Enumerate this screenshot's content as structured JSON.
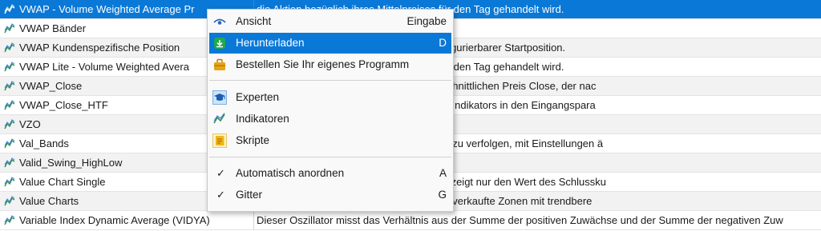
{
  "rows": [
    {
      "name": "VWAP - Volume Weighted Average Pr",
      "desc": "die Aktion bezüglich ihres Mittelpreises für den Tag gehandelt wird."
    },
    {
      "name": "VWAP Bänder",
      "desc": ""
    },
    {
      "name": "VWAP Kundenspezifische Position",
      "desc": "erage Price) Berechnung, jedoch mit konfigurierbarer Startposition."
    },
    {
      "name": "VWAP Lite - Volume Weighted Avera",
      "desc": "die Aktion bezüglich ihres Mittelpreises für den Tag gehandelt wird."
    },
    {
      "name": "VWAP_Close",
      "desc": "mmung der Liquidität-Punkte, den durchschnittlichen Preis Close, der nac"
    },
    {
      "name": "VWAP_Close_HTF",
      "desc": "nderungsmöglichkeit des Timeframes des Indikators in den Eingangspara"
    },
    {
      "name": "VZO",
      "desc": ""
    },
    {
      "name": "Val_Bands",
      "desc": "er Kerzen des Charts, der hilft Kurslücken zu verfolgen, mit Einstellungen ä"
    },
    {
      "name": "Valid_Swing_HighLow",
      "desc": ""
    },
    {
      "name": "Value Chart Single",
      "desc": "ginalen Value Chart, aber dieser Indikator zeigt nur den Wert des Schlussku"
    },
    {
      "name": "Value Charts",
      "desc": "reis-Indikator, er zeigt überkaufte und überverkaufte Zonen mit trendbere"
    },
    {
      "name": "Variable Index Dynamic Average (VIDYA)",
      "desc": "Dieser Oszillator misst das Verhältnis aus der Summe der positiven Zuwächse und der Summe der negativen Zuw"
    }
  ],
  "menu": {
    "items": [
      {
        "icon": "eye-icon",
        "label": "Ansicht",
        "key": "Eingabe"
      },
      {
        "icon": "download-icon",
        "label": "Herunterladen",
        "key": "D"
      },
      {
        "icon": "order-program-icon",
        "label": "Bestellen Sie Ihr eigenes Programm",
        "key": ""
      },
      {
        "icon": "experts-icon",
        "label": "Experten",
        "key": ""
      },
      {
        "icon": "indicators-icon",
        "label": "Indikatoren",
        "key": ""
      },
      {
        "icon": "scripts-icon",
        "label": "Skripte",
        "key": ""
      },
      {
        "icon": "check-icon",
        "label": "Automatisch anordnen",
        "key": "A"
      },
      {
        "icon": "check-icon",
        "label": "Gitter",
        "key": "G"
      }
    ]
  },
  "colors": {
    "selection": "#0a78d7",
    "indicator_icon": "#2e8b57"
  }
}
